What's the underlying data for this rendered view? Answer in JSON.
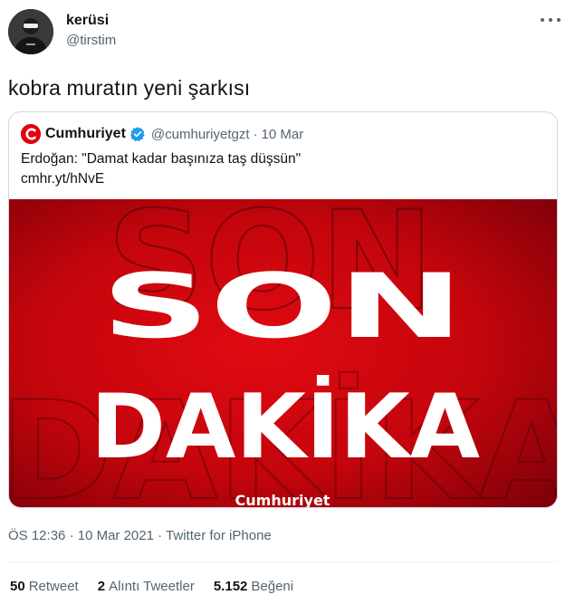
{
  "tweet": {
    "display_name": "kerüsi",
    "username": "@tirstim",
    "text": "kobra muratın yeni şarkısı",
    "more_icon": "more-horizontal-icon"
  },
  "quoted": {
    "display_name": "Cumhuriyet",
    "username": "@cumhuriyetgzt",
    "separator": "·",
    "date": "10 Mar",
    "text": "Erdoğan: \"Damat kadar başınıza taş düşsün\"",
    "link": "cmhr.yt/hNvE",
    "verified_icon": "verified-badge-icon",
    "image": {
      "headline_line1": "SON",
      "headline_line2": "DAKİKA",
      "watermark": "Cumhuriyet",
      "colors": {
        "background": "#e10a12",
        "background_dark": "#7c0009",
        "text": "#ffffff"
      }
    }
  },
  "meta": {
    "time": "ÖS 12:36",
    "separator": "·",
    "date": "10 Mar 2021",
    "source": "Twitter for iPhone"
  },
  "stats": [
    {
      "count": "50",
      "label": "Retweet"
    },
    {
      "count": "2",
      "label": "Alıntı Tweetler"
    },
    {
      "count": "5.152",
      "label": "Beğeni"
    }
  ],
  "colors": {
    "secondary_text": "#536471",
    "verified": "#1d9bf0",
    "brand_red": "#e3000f"
  }
}
